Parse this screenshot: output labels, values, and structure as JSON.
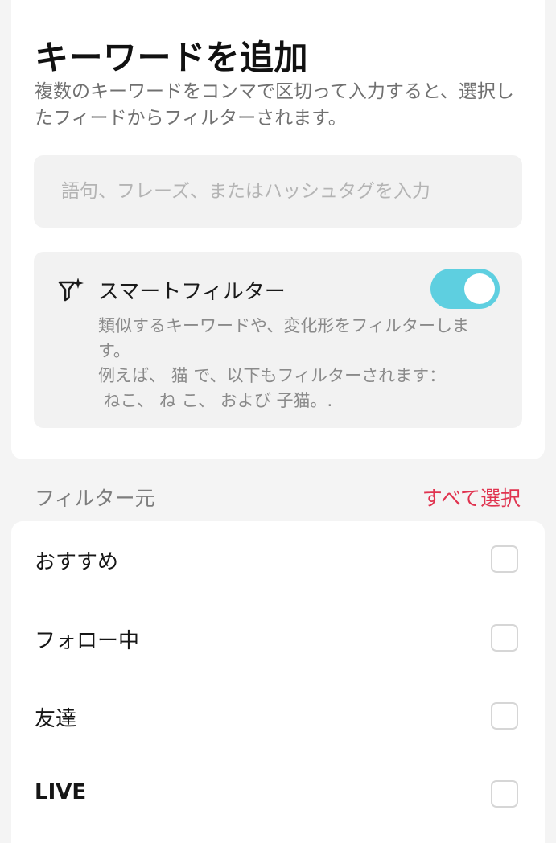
{
  "header": {
    "title": "キーワードを追加",
    "description": "複数のキーワードをコンマで区切って入力すると、選択したフィードからフィルターされます。"
  },
  "keyword_input": {
    "placeholder": "語句、フレーズ、またはハッシュタグを入力",
    "value": ""
  },
  "smart_filter": {
    "icon": "smart-filter-icon",
    "title": "スマートフィルター",
    "enabled": true,
    "description": "類似するキーワードや、変化形をフィルターします。",
    "example_line1": "例えば、 猫 で、以下もフィルターされます：",
    "example_line2": " ねこ、 ね こ、 および 子猫。.",
    "accent_color": "#5ecfe0"
  },
  "filter_source": {
    "header": "フィルター元",
    "select_all_label": "すべて選択",
    "select_all_color": "#e0334f",
    "items": [
      {
        "label": "おすすめ",
        "checked": false
      },
      {
        "label": "フォロー中",
        "checked": false
      },
      {
        "label": "友達",
        "checked": false
      },
      {
        "label": "LIVE",
        "checked": false
      }
    ]
  }
}
